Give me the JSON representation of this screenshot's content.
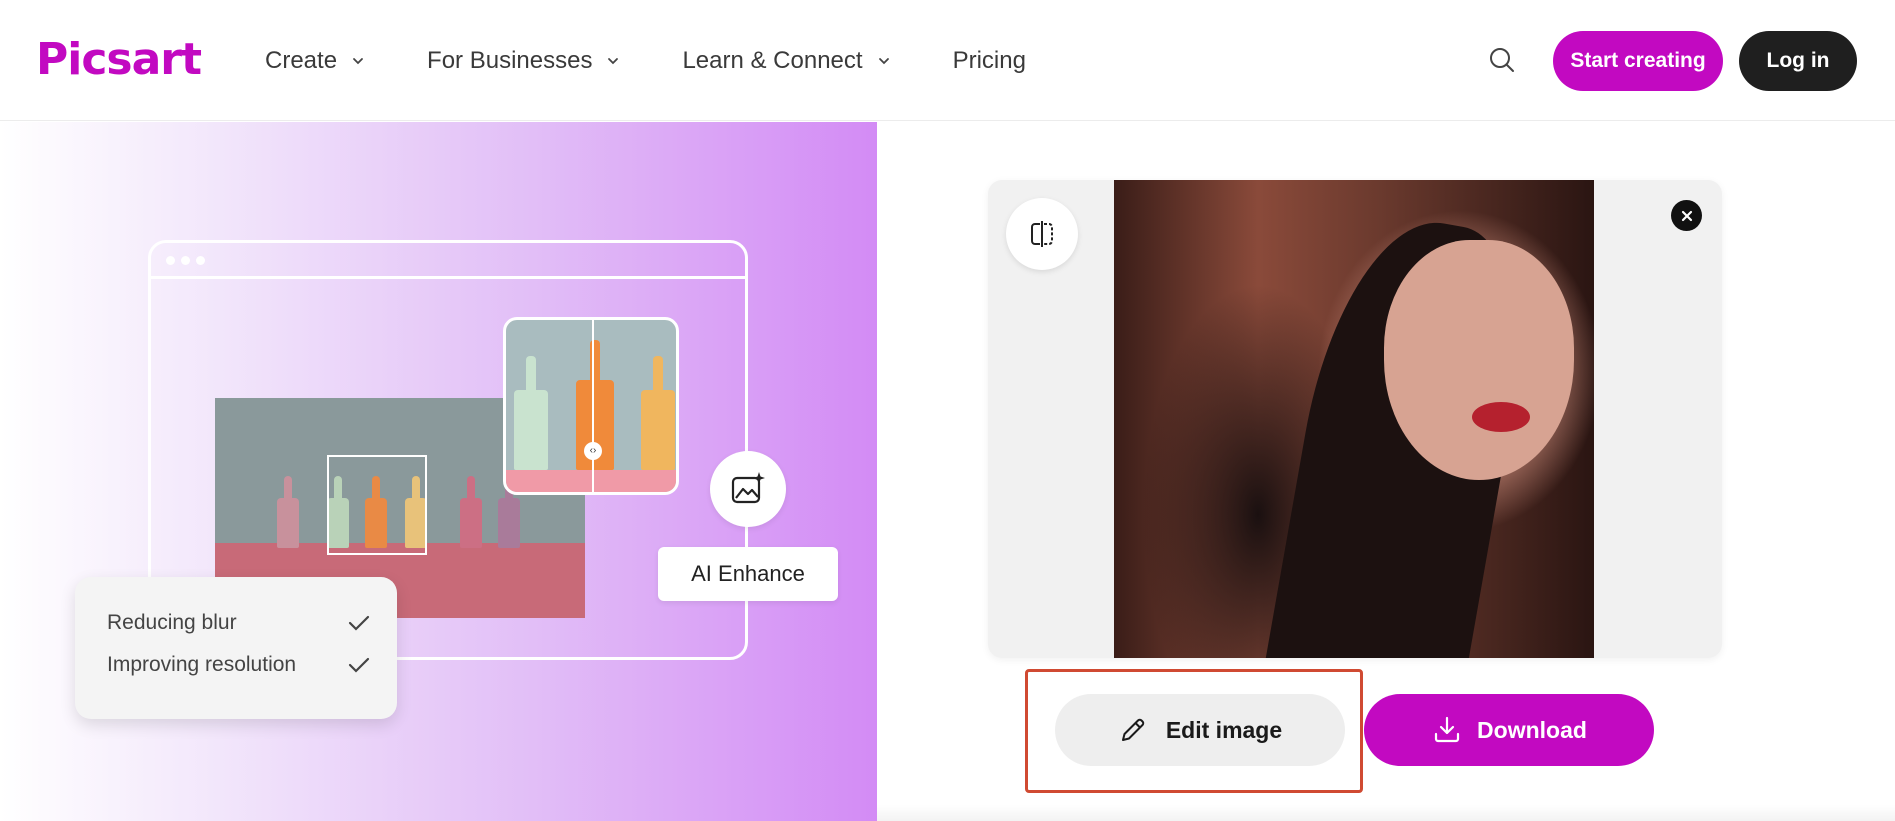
{
  "header": {
    "logo": "Picsart",
    "nav": [
      {
        "label": "Create",
        "dropdown": true
      },
      {
        "label": "For Businesses",
        "dropdown": true
      },
      {
        "label": "Learn & Connect",
        "dropdown": true
      },
      {
        "label": "Pricing",
        "dropdown": false
      }
    ],
    "search_icon": "search-icon",
    "start_label": "Start creating",
    "login_label": "Log in"
  },
  "promo": {
    "badge_label": "AI Enhance",
    "badge_icon": "image-sparkle-icon",
    "status": [
      {
        "label": "Reducing blur",
        "icon": "check-icon"
      },
      {
        "label": "Improving resolution",
        "icon": "check-icon"
      }
    ]
  },
  "result": {
    "compare_icon": "compare-split-icon",
    "close_icon": "close-icon",
    "edit_label": "Edit image",
    "edit_icon": "pencil-icon",
    "download_label": "Download",
    "download_icon": "download-icon"
  },
  "colors": {
    "brand": "#c209c1",
    "dark_button": "#1f1f1f",
    "highlight": "#d04a32"
  }
}
